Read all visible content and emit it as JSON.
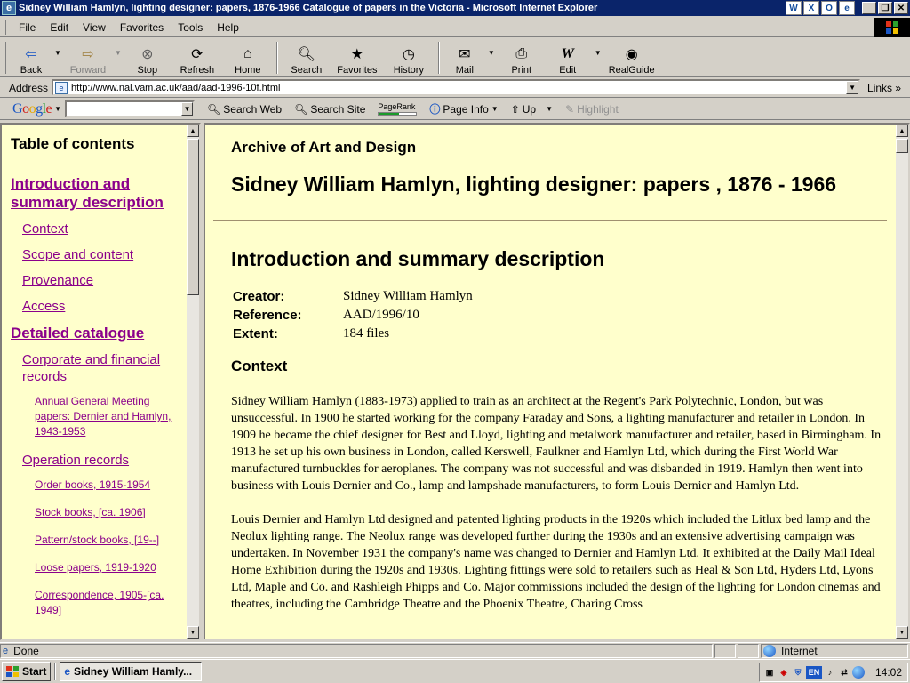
{
  "window": {
    "title": "Sidney William Hamlyn, lighting designer: papers, 1876-1966 Catalogue of papers in the Victoria - Microsoft Internet Explorer"
  },
  "menu": {
    "items": [
      "File",
      "Edit",
      "View",
      "Favorites",
      "Tools",
      "Help"
    ]
  },
  "toolbar": {
    "back": "Back",
    "forward": "Forward",
    "stop": "Stop",
    "refresh": "Refresh",
    "home": "Home",
    "search": "Search",
    "favorites": "Favorites",
    "history": "History",
    "mail": "Mail",
    "print": "Print",
    "edit": "Edit",
    "realguide": "RealGuide"
  },
  "address": {
    "label": "Address",
    "url": "http://www.nal.vam.ac.uk/aad/aad-1996-10f.html",
    "links": "Links"
  },
  "google": {
    "logo": "Google",
    "search_web": "Search Web",
    "search_site": "Search Site",
    "pagerank": "PageRank",
    "pagerank_level": 0.55,
    "page_info": "Page Info",
    "up": "Up",
    "highlight": "Highlight"
  },
  "toc": {
    "title": "Table of contents",
    "items": [
      {
        "label": "Introduction and summary description",
        "level": 1
      },
      {
        "label": "Context",
        "level": 2
      },
      {
        "label": "Scope and content",
        "level": 2
      },
      {
        "label": "Provenance",
        "level": 2
      },
      {
        "label": "Access",
        "level": 2
      },
      {
        "label": "Detailed catalogue",
        "level": 1
      },
      {
        "label": "Corporate and financial records",
        "level": 2
      },
      {
        "label": "Annual General Meeting papers: Dernier and Hamlyn, 1943-1953",
        "level": 3
      },
      {
        "label": "Operation records",
        "level": 2
      },
      {
        "label": "Order books, 1915-1954",
        "level": 3
      },
      {
        "label": "Stock books, [ca. 1906]",
        "level": 3
      },
      {
        "label": "Pattern/stock books, [19--]",
        "level": 3
      },
      {
        "label": "Loose papers, 1919-1920",
        "level": 3
      },
      {
        "label": "Correspondence, 1905-[ca. 1949]",
        "level": 3
      }
    ]
  },
  "document": {
    "archive": "Archive of Art and Design",
    "title": "Sidney William Hamlyn, lighting designer: papers , 1876 - 1966",
    "section_title": "Introduction and summary description",
    "meta": [
      {
        "key": "Creator:",
        "value": "Sidney William Hamlyn"
      },
      {
        "key": "Reference:",
        "value": "AAD/1996/10"
      },
      {
        "key": "Extent:",
        "value": "184 files"
      }
    ],
    "context_heading": "Context",
    "paragraphs": [
      "Sidney William Hamlyn (1883-1973) applied to train as an architect at the Regent's Park Polytechnic, London, but was unsuccessful. In 1900 he started working for the company Faraday and Sons, a lighting manufacturer and retailer in London. In 1909 he became the chief designer for Best and Lloyd, lighting and metalwork manufacturer and retailer, based in Birmingham. In 1913 he set up his own business in London, called Kerswell, Faulkner and Hamlyn Ltd, which during the First World War manufactured turnbuckles for aeroplanes. The company was not successful and was disbanded in 1919. Hamlyn then went into business with Louis Dernier and Co., lamp and lampshade manufacturers, to form Louis Dernier and Hamlyn Ltd.",
      "Louis Dernier and Hamlyn Ltd designed and patented lighting products in the 1920s which included the Litlux bed lamp and the Neolux lighting range. The Neolux range was developed further during the 1930s and an extensive advertising campaign was undertaken. In November 1931 the company's name was changed to Dernier and Hamlyn Ltd. It exhibited at the Daily Mail Ideal Home Exhibition during the 1920s and 1930s. Lighting fittings were sold to retailers such as Heal & Son Ltd, Hyders Ltd, Lyons Ltd, Maple and Co. and Rashleigh Phipps and Co. Major commissions included the design of the lighting for London cinemas and theatres, including the Cambridge Theatre and the Phoenix Theatre, Charing Cross"
    ]
  },
  "status": {
    "text": "Done",
    "zone": "Internet"
  },
  "taskbar": {
    "start": "Start",
    "task": "Sidney William Hamly...",
    "clock": "14:02",
    "tray_lang": "EN"
  }
}
